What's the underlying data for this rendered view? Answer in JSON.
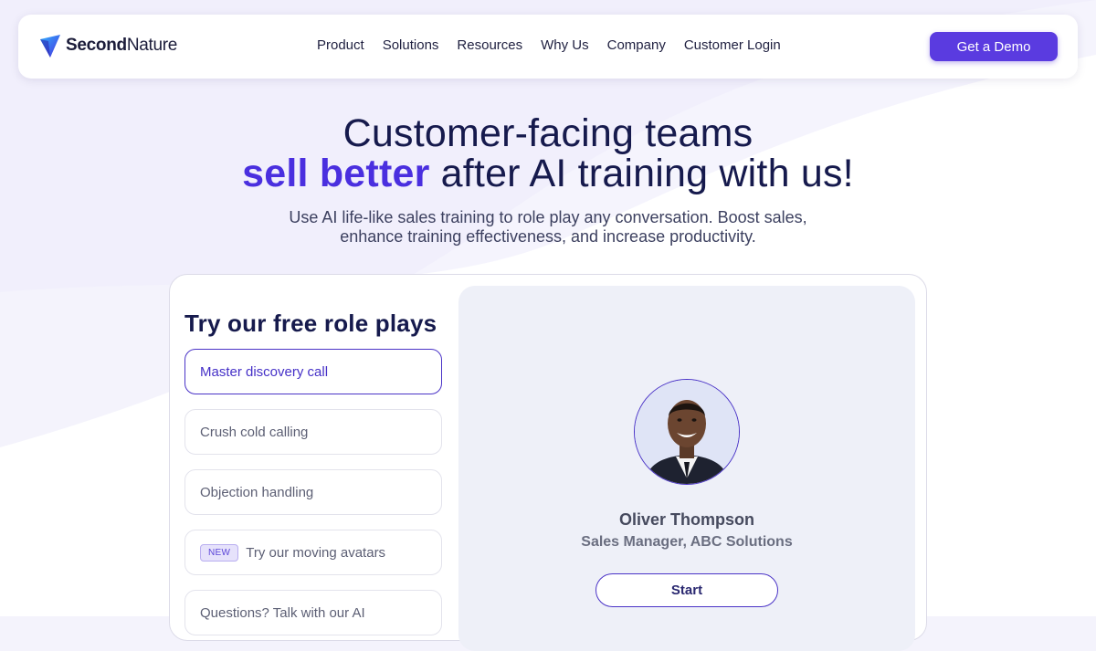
{
  "brand": {
    "logo_text_bold": "Second",
    "logo_text_rest": "Nature",
    "accent": "#5a3be0",
    "navy": "#161a4d"
  },
  "nav": {
    "links": [
      "Product",
      "Solutions",
      "Resources",
      "Why Us",
      "Company",
      "Customer Login"
    ],
    "cta_label": "Get a Demo"
  },
  "hero": {
    "title_line1": "Customer-facing teams",
    "title_highlight": "sell better",
    "title_line2_rest": " after AI training with us!",
    "subtitle_line1": "Use AI life-like sales training to role play any conversation. Boost sales,",
    "subtitle_line2": "enhance training effectiveness, and increase productivity."
  },
  "roleplays": {
    "title": "Try our free role plays",
    "options": [
      {
        "label": "Master discovery call",
        "active": true
      },
      {
        "label": "Crush cold calling",
        "active": false
      },
      {
        "label": "Objection handling",
        "active": false
      },
      {
        "label": "Try our moving avatars",
        "badge": "NEW",
        "active": false
      },
      {
        "label": "Questions? Talk with our AI",
        "active": false
      }
    ]
  },
  "persona": {
    "name": "Oliver Thompson",
    "role": "Sales Manager, ABC Solutions",
    "start_label": "Start",
    "avatar_icon": "person-portrait-icon"
  }
}
